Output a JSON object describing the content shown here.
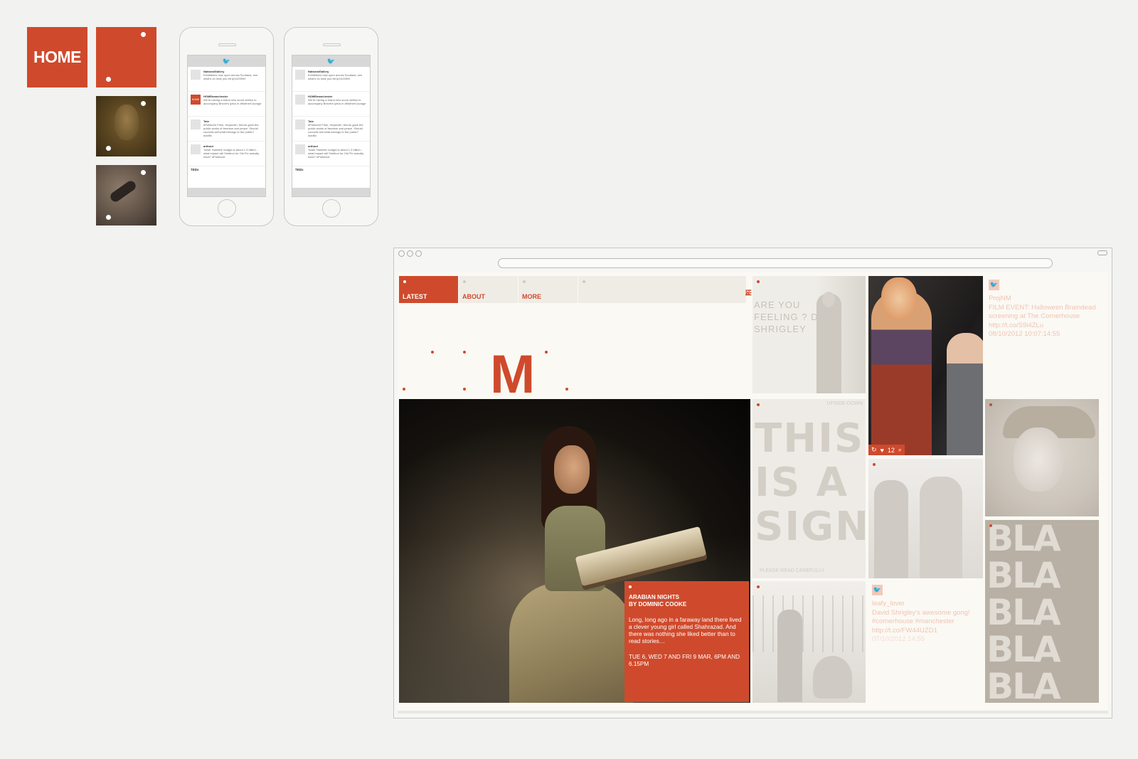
{
  "brand": {
    "logo_text": "HOME",
    "accent_color": "#cf4a2c"
  },
  "phones": [
    {
      "header_icon": "twitter-bird-icon",
      "tweets": [
        {
          "user": "NationalGallery",
          "time": "8m",
          "text": "Exhibitions now open across Scotland, see what's on near you bit.ly/1420592",
          "meta": "Retweeted by richardsmith"
        },
        {
          "user": "HOMEmanchester",
          "time": "12m",
          "text": "We're having a brand new score written to accompany Brecht's lyrics in #MotherCourage",
          "meta": "Retweeted by richardsmith",
          "avatar": "HOME"
        },
        {
          "user": "Tate",
          "time": "23m",
          "text": "#PublicArt Frink, Hepworth, Moore gave the public works of freedom and peace. Should councils sell what belongs to the public? #oldflo",
          "meta": "By verpeit-daniela"
        },
        {
          "user": "artfund",
          "time": "39m",
          "text": "Tower Hamlets' budget is about 1.3 billion - what impact will Smithon for Old Flo actually have? #PublicArt",
          "meta": "By verpeit-daniela"
        }
      ],
      "tail_user": "TEDx"
    },
    {
      "header_icon": "twitter-bird-icon",
      "tweets": [
        {
          "user": "NationalGallery",
          "time": "8m",
          "text": "Exhibitions now open across Scotland, see what's on near you bit.ly/1420592",
          "meta": "Retweeted by richardsmith"
        },
        {
          "user": "HOMEmanchester",
          "time": "12m",
          "text": "We're having a brand new score written to accompany Brecht's lyrics in #MotherCourage",
          "meta": "Retweeted by richardsmith"
        },
        {
          "user": "Tate",
          "time": "23m",
          "text": "#PublicArt Frink, Hepworth, Moore gave the public works of freedom and peace. Should councils sell what belongs to the public? #oldflo",
          "meta": "By verpeit-daniela"
        },
        {
          "user": "artfund",
          "time": "39m",
          "text": "Tower Hamlets' budget is about 1.3 billion - what impact will Smithon for Old Flo actually have? #PublicArt",
          "meta": "By verpeit-daniela"
        }
      ],
      "tail_user": "TEDx"
    }
  ],
  "site": {
    "nav": {
      "latest": "LATEST",
      "about": "ABOUT",
      "more": "MORE"
    },
    "toolbar_icons": [
      "search-icon",
      "list-view-icon",
      "grid-view-icon"
    ],
    "logo_letter": "M",
    "feature": {
      "title_line1": "ARABIAN NIGHTS",
      "title_line2": "BY DOMINIC COOKE",
      "body": "Long, long ago in a faraway land there lived a clever young girl called Shahrazad. And there was nothing she liked better than to read stories…",
      "dates": "TUE 6, WED 7 AND FRI 9 MAR, 6PM AND 6.15PM"
    },
    "tweet_card_1": {
      "user": "ProjNM",
      "text": "FILM EVENT: Halloween Braindead screening at The Cornerhouse http://t.co/S9i4ZLu",
      "timestamp": "08/10/2012 10:07:14:55"
    },
    "tweet_card_2": {
      "user": "leafy_lover",
      "text": "David Shrigley's awesome gong! #cornerhouse #manchester http://t.co/FW44UZD1",
      "timestamp": "07/10/2012 14:55"
    },
    "instagram_stats": {
      "likes": "12"
    },
    "artwork_text": {
      "feeling": "ARE YOU FEELING ? D. SHRIGLEY",
      "sign_small": "UPSIDE-DOWN",
      "sign_big": "THIS IS A SIGN",
      "sign_footer": "PLEASE READ CAREFULLY",
      "bla": "BLA BLA BLA BLA BLA"
    }
  }
}
